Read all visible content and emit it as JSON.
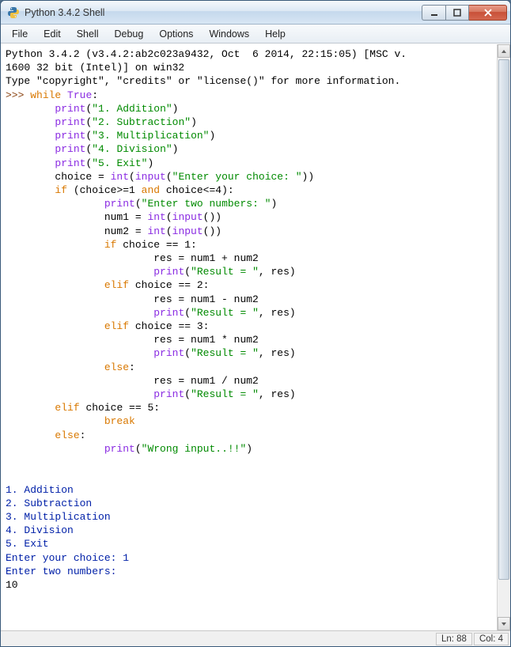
{
  "window": {
    "title": "Python 3.4.2 Shell"
  },
  "menu": {
    "items": [
      "File",
      "Edit",
      "Shell",
      "Debug",
      "Options",
      "Windows",
      "Help"
    ]
  },
  "shell": {
    "banner1": "Python 3.4.2 (v3.4.2:ab2c023a9432, Oct  6 2014, 22:15:05) [MSC v.",
    "banner2": "1600 32 bit (Intel)] on win32",
    "banner3": "Type \"copyright\", \"credits\" or \"license()\" for more information.",
    "prompt": ">>> ",
    "kw_while": "while",
    "kw_true": "True",
    "colon": ":",
    "fn_print": "print",
    "fn_int": "int",
    "fn_input": "input",
    "lp": "(",
    "rp": ")",
    "s_add": "\"1. Addition\"",
    "s_sub": "\"2. Subtraction\"",
    "s_mul": "\"3. Multiplication\"",
    "s_div": "\"4. Division\"",
    "s_exit": "\"5. Exit\"",
    "l_choice_eq": "        choice = ",
    "s_prompt_choice": "\"Enter your choice: \"",
    "kw_if": "if",
    "if_cond_l": " (choice>=1 ",
    "kw_and": "and",
    "if_cond_r": " choice<=4):",
    "s_two_nums": "\"Enter two numbers: \"",
    "l_num1": "                num1 = ",
    "l_num2": "                num2 = ",
    "l_if_choice1": "                ",
    "if_choice1": " choice == 1:",
    "l_res_add": "                        res = num1 + num2",
    "s_result": "\"Result = \"",
    "res_tail": ", res)",
    "kw_elif": "elif",
    "if_choice2": " choice == 2:",
    "l_res_sub": "                        res = num1 - num2",
    "if_choice3": " choice == 3:",
    "l_res_mul": "                        res = num1 * num2",
    "kw_else": "else",
    "l_res_div": "                        res = num1 / num2",
    "if_choice5": " choice == 5:",
    "kw_break": "break",
    "s_wrong": "\"Wrong input..!!\"",
    "out1": "1. Addition",
    "out2": "2. Subtraction",
    "out3": "3. Multiplication",
    "out4": "4. Division",
    "out5": "5. Exit",
    "out6": "Enter your choice: 1",
    "out7": "Enter two numbers: ",
    "out8": "10"
  },
  "status": {
    "ln": "Ln: 88",
    "col": "Col: 4"
  }
}
